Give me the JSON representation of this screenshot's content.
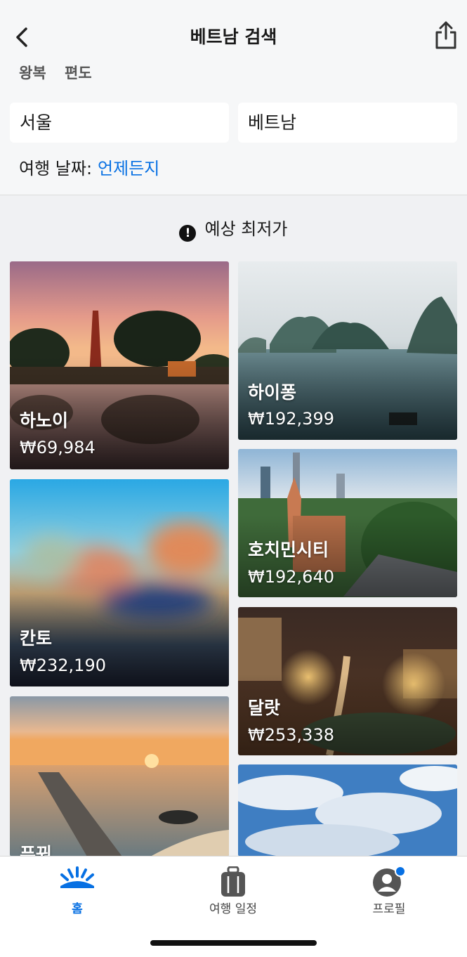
{
  "header": {
    "title": "베트남 검색",
    "back_icon": "chevron-left-icon",
    "share_icon": "share-icon",
    "trip_types": [
      "왕복",
      "편도"
    ],
    "origin": "서울",
    "destination": "베트남",
    "date_label": "여행 날짜:",
    "date_value": "언제든지"
  },
  "notice": {
    "icon": "alert-circle-icon",
    "text": "예상 최저가"
  },
  "destinations": [
    {
      "city": "하노이",
      "price": "₩69,984"
    },
    {
      "city": "하이퐁",
      "price": "₩192,399"
    },
    {
      "city": "호치민시티",
      "price": "₩192,640"
    },
    {
      "city": "칸토",
      "price": "₩232,190"
    },
    {
      "city": "달랏",
      "price": "₩253,338"
    },
    {
      "city": "푸꿔",
      "price": ""
    },
    {
      "city": "",
      "price": ""
    }
  ],
  "tabbar": {
    "items": [
      {
        "label": "홈",
        "icon": "sunrise-home-icon",
        "active": true
      },
      {
        "label": "여행 일정",
        "icon": "suitcase-icon",
        "active": false
      },
      {
        "label": "프로필",
        "icon": "profile-icon",
        "active": false
      }
    ],
    "accent": "#0770e3",
    "badge_color": "#0770e3"
  }
}
